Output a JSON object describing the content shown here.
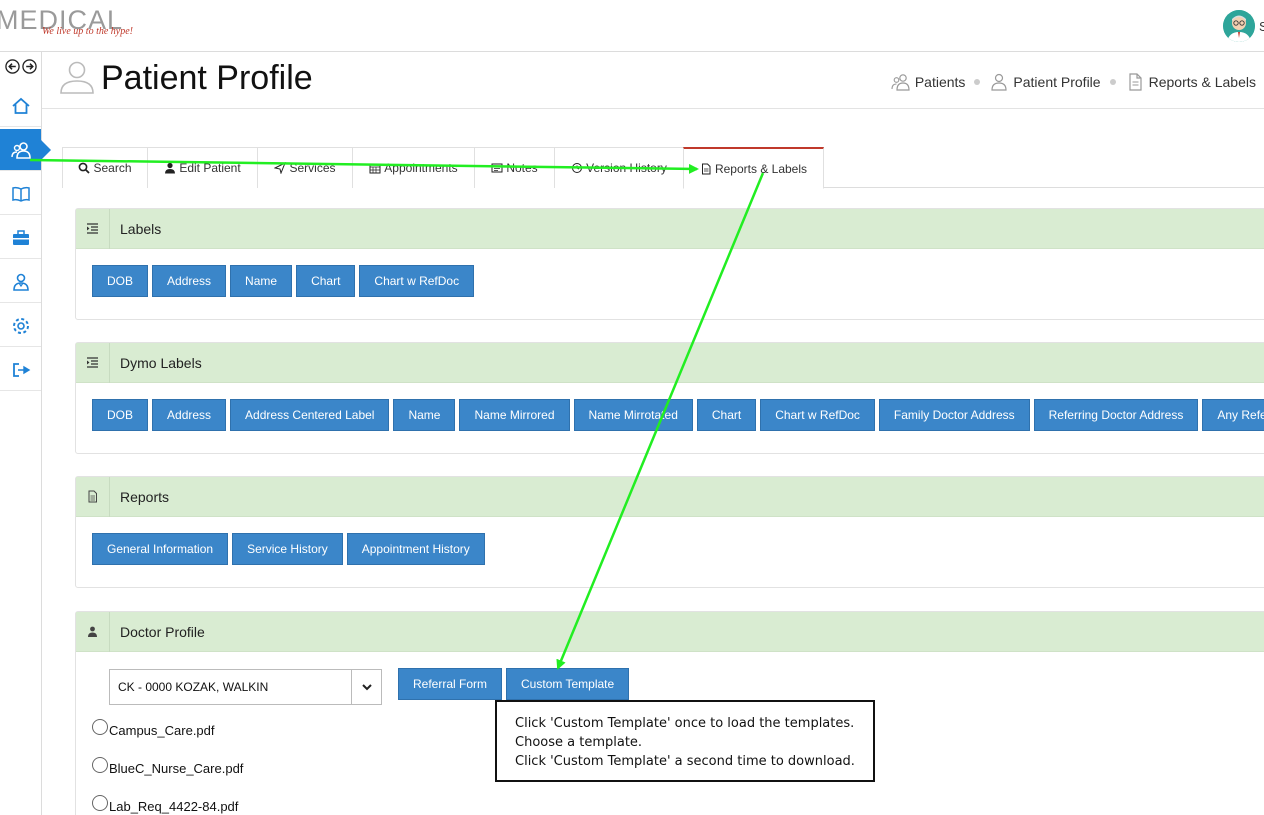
{
  "app": {
    "logo_word": "MEDICAL",
    "logo_tagline": "We live up to the hype!",
    "user_initial": "S"
  },
  "header": {
    "title": "Patient Profile",
    "breadcrumb": [
      "Patients",
      "Patient Profile",
      "Reports & Labels"
    ]
  },
  "tabs": [
    {
      "label": "Search",
      "icon": "search-icon"
    },
    {
      "label": "Edit Patient",
      "icon": "user-icon"
    },
    {
      "label": "Services",
      "icon": "send-icon"
    },
    {
      "label": "Appointments",
      "icon": "calendar-icon"
    },
    {
      "label": "Notes",
      "icon": "notes-icon"
    },
    {
      "label": "Version History",
      "icon": "history-icon"
    },
    {
      "label": "Reports & Labels",
      "icon": "file-icon",
      "active": true
    }
  ],
  "labels_panel": {
    "title": "Labels",
    "buttons": [
      "DOB",
      "Address",
      "Name",
      "Chart",
      "Chart w RefDoc"
    ]
  },
  "dymo_panel": {
    "title": "Dymo Labels",
    "buttons": [
      "DOB",
      "Address",
      "Address Centered Label",
      "Name",
      "Name Mirrored",
      "Name Mirrotated",
      "Chart",
      "Chart w RefDoc",
      "Family Doctor Address",
      "Referring Doctor Address",
      "Any Referring"
    ]
  },
  "reports_panel": {
    "title": "Reports",
    "buttons": [
      "General Information",
      "Service History",
      "Appointment History"
    ]
  },
  "doctor_panel": {
    "title": "Doctor Profile",
    "selected_doctor": "CK - 0000 KOZAK, WALKIN",
    "buttons": [
      "Referral Form",
      "Custom Template"
    ],
    "templates": [
      "Campus_Care.pdf",
      "BlueC_Nurse_Care.pdf",
      "Lab_Req_4422-84.pdf"
    ]
  },
  "annotation": {
    "lines": [
      "Click 'Custom Template' once to load the templates.",
      "Choose a template.",
      "Click 'Custom Template' a second time to download."
    ],
    "arrow_color": "#22ee22"
  },
  "colors": {
    "accent": "#1f82d6",
    "button": "#3b86c9",
    "panel_header": "#d9ecd2",
    "active_tab_border": "#c0392b"
  }
}
